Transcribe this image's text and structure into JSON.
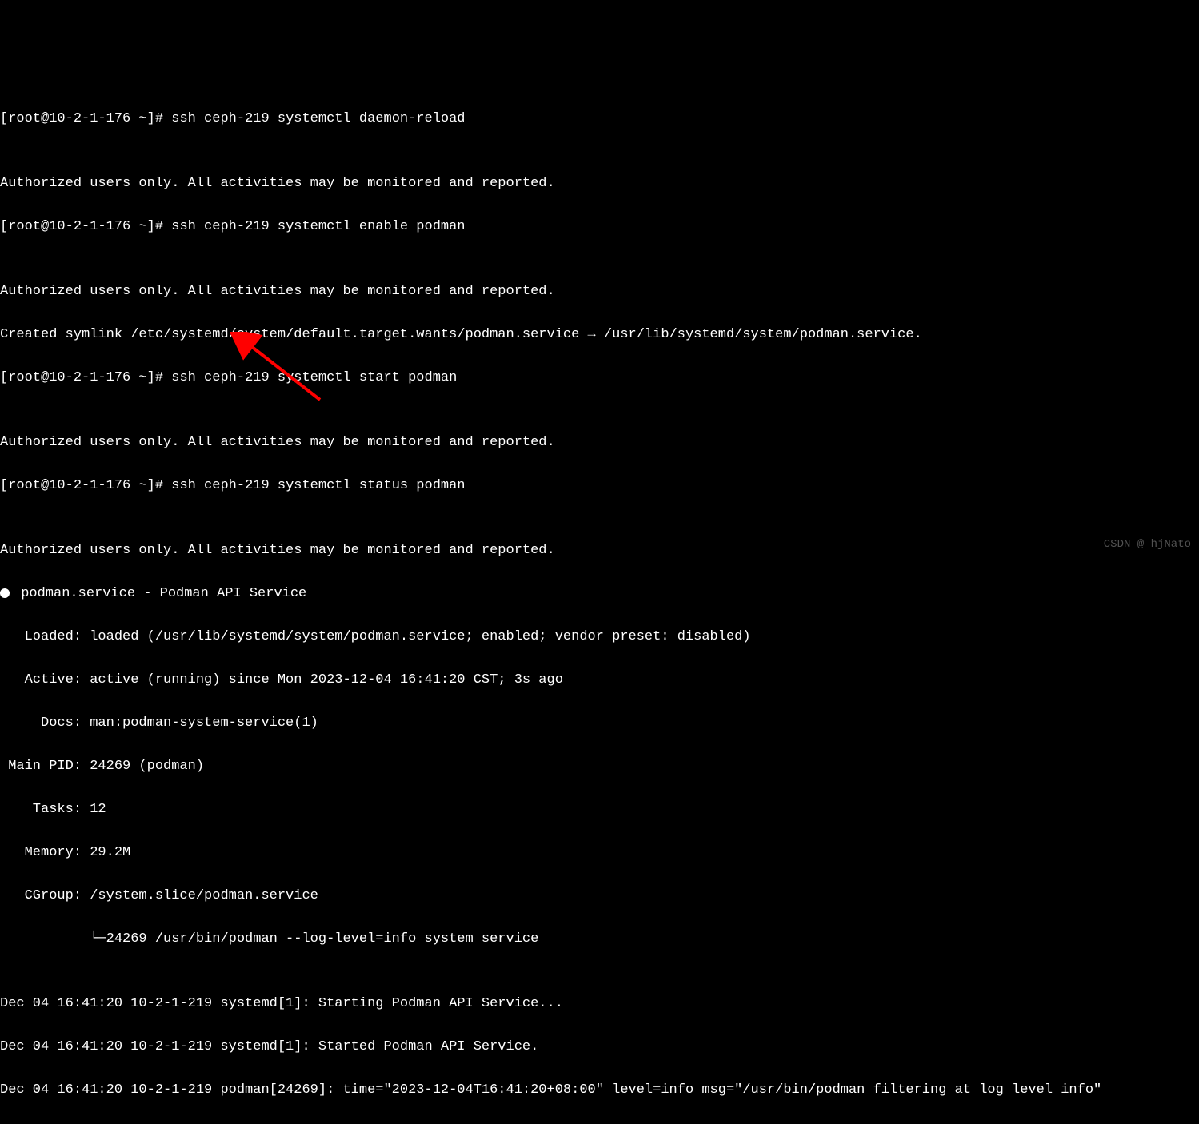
{
  "lines": {
    "l1_prompt": "[root@10-2-1-176 ~]# ",
    "l1_cmd": "ssh ceph-219 systemctl daemon-reload",
    "l2_blank": "",
    "l3": "Authorized users only. All activities may be monitored and reported.",
    "l4_prompt": "[root@10-2-1-176 ~]# ",
    "l4_cmd": "ssh ceph-219 systemctl enable podman",
    "l5_blank": "",
    "l6": "Authorized users only. All activities may be monitored and reported.",
    "l7": "Created symlink /etc/systemd/system/default.target.wants/podman.service → /usr/lib/systemd/system/podman.service.",
    "l8_prompt": "[root@10-2-1-176 ~]# ",
    "l8_cmd": "ssh ceph-219 systemctl start podman",
    "l9_blank": "",
    "l10": "Authorized users only. All activities may be monitored and reported.",
    "l11_prompt": "[root@10-2-1-176 ~]# ",
    "l11_cmd": "ssh ceph-219 systemctl status podman",
    "l12_blank": "",
    "l13": "Authorized users only. All activities may be monitored and reported.",
    "l14": " podman.service - Podman API Service",
    "l15": "   Loaded: loaded (/usr/lib/systemd/system/podman.service; enabled; vendor preset: disabled)",
    "l16": "   Active: active (running) since Mon 2023-12-04 16:41:20 CST; 3s ago",
    "l17": "     Docs: man:podman-system-service(1)",
    "l18": " Main PID: 24269 (podman)",
    "l19": "    Tasks: 12",
    "l20": "   Memory: 29.2M",
    "l21": "   CGroup: /system.slice/podman.service",
    "l22": "           └─24269 /usr/bin/podman --log-level=info system service",
    "l23_blank": "",
    "l24": "Dec 04 16:41:20 10-2-1-219 systemd[1]: Starting Podman API Service...",
    "l25": "Dec 04 16:41:20 10-2-1-219 systemd[1]: Started Podman API Service.",
    "l26": "Dec 04 16:41:20 10-2-1-219 podman[24269]: time=\"2023-12-04T16:41:20+08:00\" level=info msg=\"/usr/bin/podman filtering at log level info\""
  },
  "watermark": "CSDN @ hjNato"
}
